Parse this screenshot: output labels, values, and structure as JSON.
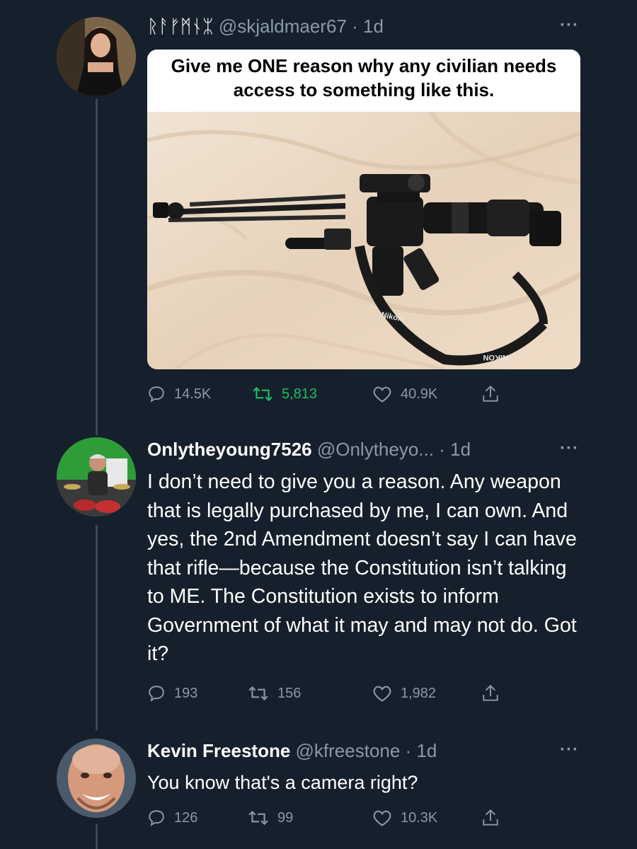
{
  "colors": {
    "background": "#16202c",
    "text_primary": "#ffffff",
    "text_secondary": "#8899a6",
    "retweet_active": "#17bf63",
    "thread_line": "#3d4a59"
  },
  "tweets": [
    {
      "display_name": "ᚱᚨᚠᛗᚾᛯ",
      "handle": "@skjaldmaer67",
      "time": "· 1d",
      "more_icon": "more-dots-icon",
      "media": {
        "caption": "Give me ONE reason why any civilian needs access to something like this.",
        "strap_labels": [
          "Nikon",
          "NIKON"
        ]
      },
      "replies": "14.5K",
      "retweets": "5,813",
      "likes": "40.9K",
      "retweeted": true
    },
    {
      "display_name": "Onlytheyoung7526",
      "handle": "@Onlytheyo...",
      "time": "· 1d",
      "more_icon": "more-dots-icon",
      "text": "I don’t need to give you a reason. Any weapon that is legally purchased by me, I can own. And yes, the 2nd Amendment doesn’t say I can have that rifle—because the Constitution isn’t talking to ME. The Constitution exists to inform Government of what it may and may not do. Got it?",
      "replies": "193",
      "retweets": "156",
      "likes": "1,982",
      "retweeted": false
    },
    {
      "display_name": "Kevin Freestone",
      "handle": "@kfreestone",
      "time": "· 1d",
      "more_icon": "more-dots-icon",
      "text": "You know that's a camera right?",
      "replies": "126",
      "retweets": "99",
      "likes": "10.3K",
      "retweeted": false
    }
  ],
  "icons": {
    "reply": "reply-icon",
    "retweet": "retweet-icon",
    "like": "heart-icon",
    "share": "share-icon"
  }
}
